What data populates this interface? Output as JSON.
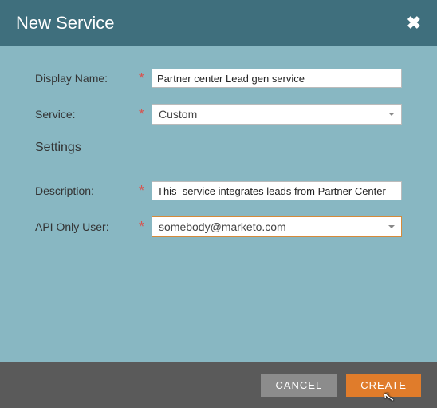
{
  "dialog": {
    "title": "New Service",
    "close_glyph": "✖"
  },
  "fields": {
    "display_name": {
      "label": "Display Name:",
      "value": "Partner center Lead gen service"
    },
    "service": {
      "label": "Service:",
      "value": "Custom"
    },
    "description": {
      "label": "Description:",
      "value": "This  service integrates leads from Partner Center"
    },
    "api_user": {
      "label": "API Only User:",
      "value": "somebody@marketo.com"
    }
  },
  "section": {
    "settings": "Settings"
  },
  "required_glyph": "*",
  "footer": {
    "cancel": "CANCEL",
    "create": "CREATE"
  }
}
